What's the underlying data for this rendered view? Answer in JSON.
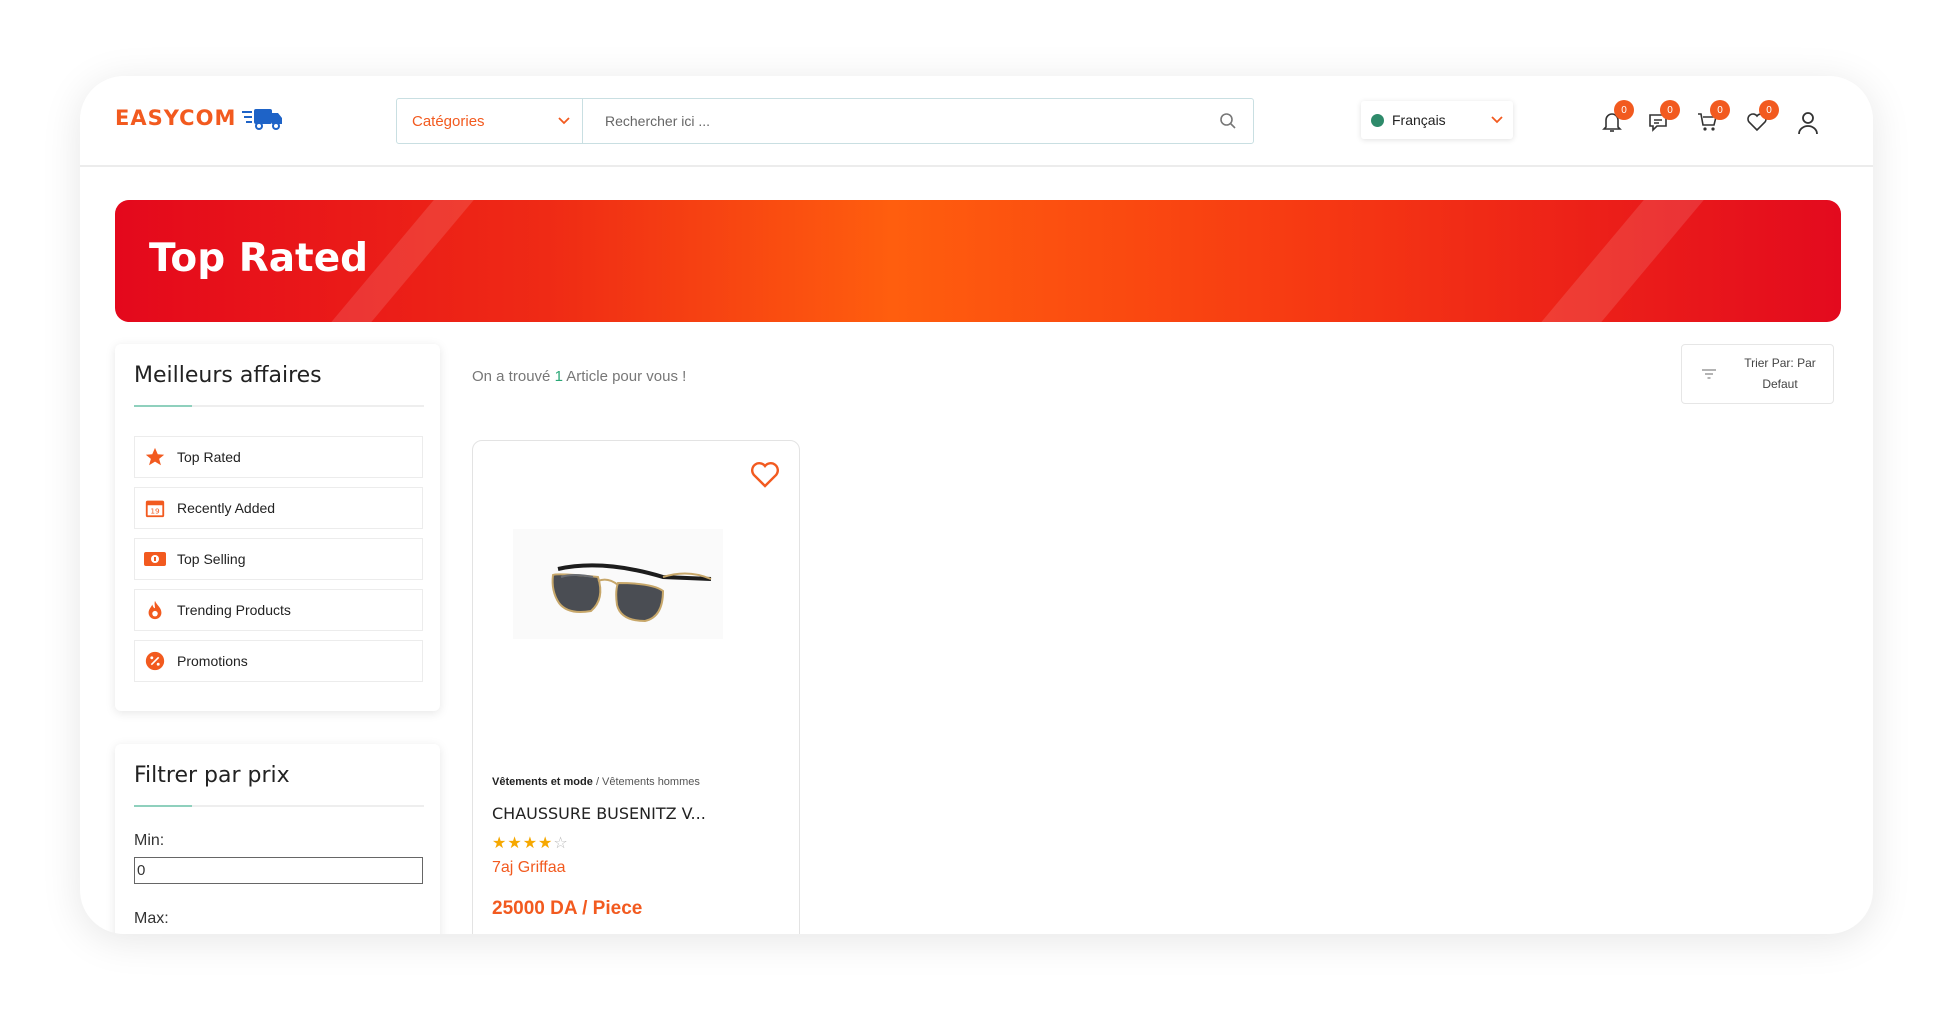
{
  "header": {
    "logo_text": "EASYCOM",
    "categories_label": "Catégories",
    "search_placeholder": "Rechercher ici ...",
    "language": "Français",
    "badges": {
      "notifications": "0",
      "messages": "0",
      "cart": "0",
      "wishlist": "0"
    }
  },
  "banner": {
    "title": "Top Rated"
  },
  "deals": {
    "title": "Meilleurs affaires",
    "items": [
      {
        "label": "Top Rated",
        "icon": "star-icon"
      },
      {
        "label": "Recently Added",
        "icon": "calendar-icon",
        "icon_text": "19"
      },
      {
        "label": "Top Selling",
        "icon": "money-icon"
      },
      {
        "label": "Trending Products",
        "icon": "fire-icon"
      },
      {
        "label": "Promotions",
        "icon": "discount-icon"
      }
    ]
  },
  "price_filter": {
    "title": "Filtrer par prix",
    "min_label": "Min:",
    "min_value": "0",
    "max_label": "Max:"
  },
  "results": {
    "prefix": "On a trouvé",
    "count": "1",
    "suffix": "Article pour vous !"
  },
  "sort": {
    "label": "Trier Par: Par Defaut"
  },
  "product": {
    "category": "Vêtements et mode",
    "subcategory": "/ Vêtements hommes",
    "name": "CHAUSSURE BUSENITZ V...",
    "rating": 4,
    "rating_max": 5,
    "stars_on": "★★★★",
    "stars_off": "☆",
    "seller": "7aj Griffaa",
    "price": "25000 DA / Piece"
  },
  "colors": {
    "accent": "#f25a1f",
    "banner_red": "#e4081c",
    "banner_orange": "#ff5e0e",
    "count_green": "#2aa776",
    "star": "#f6a800"
  }
}
